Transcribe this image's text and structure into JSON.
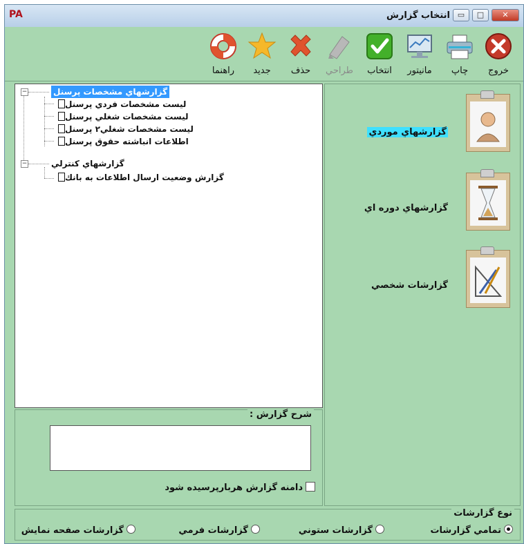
{
  "window": {
    "logo": "PA",
    "title": "انتخاب گزارش",
    "close_glyph": "✕",
    "max_glyph": "□",
    "min_glyph": "▭"
  },
  "toolbar": [
    {
      "id": "exit",
      "label": "خروج",
      "icon": "exit-icon",
      "enabled": true
    },
    {
      "id": "print",
      "label": "چاپ",
      "icon": "printer-icon",
      "enabled": true
    },
    {
      "id": "monitor",
      "label": "مانیتور",
      "icon": "monitor-icon",
      "enabled": true
    },
    {
      "id": "select",
      "label": "انتخاب",
      "icon": "check-icon",
      "enabled": true
    },
    {
      "id": "design",
      "label": "طراحي",
      "icon": "design-icon",
      "enabled": false
    },
    {
      "id": "delete",
      "label": "حذف",
      "icon": "delete-icon",
      "enabled": true
    },
    {
      "id": "new",
      "label": "جديد",
      "icon": "star-icon",
      "enabled": true
    },
    {
      "id": "help",
      "label": "راهنما",
      "icon": "lifebuoy-icon",
      "enabled": true
    }
  ],
  "tree": {
    "group1": "گزارشهاي مشخصات پرسنل",
    "items1": [
      "ليست مشخصات فردي پرسنل",
      "ليست مشخصات شغلي پرسنل",
      "ليست مشخصات شغلي۲ پرسنل",
      "اطلاعات انباشته حقوق پرسنل"
    ],
    "group2": "گزارشهاي كنترلي",
    "items2": [
      "گزارش وضعيت ارسال اطلاعات به بانك"
    ]
  },
  "description": {
    "title": "شرح گزارش :",
    "text": "",
    "checkbox_label": "دامنه گزارش هربارپرسيده شود",
    "checked": false
  },
  "categories": [
    {
      "label": "گزارشهاي موردي",
      "icon": "person-clipboard-icon",
      "highlighted": true
    },
    {
      "label": "گزارشهاي دوره اي",
      "icon": "hourglass-clipboard-icon",
      "highlighted": false
    },
    {
      "label": "گزارشات شخصي",
      "icon": "drafting-clipboard-icon",
      "highlighted": false
    }
  ],
  "report_type": {
    "title": "نوع گزارشات",
    "options": [
      {
        "label": "تمامي گزارشات",
        "selected": true
      },
      {
        "label": "گزارشات ستوني",
        "selected": false
      },
      {
        "label": "گزارشات فرمي",
        "selected": false
      },
      {
        "label": "گزارشات صفحه نمايش",
        "selected": false
      }
    ]
  }
}
